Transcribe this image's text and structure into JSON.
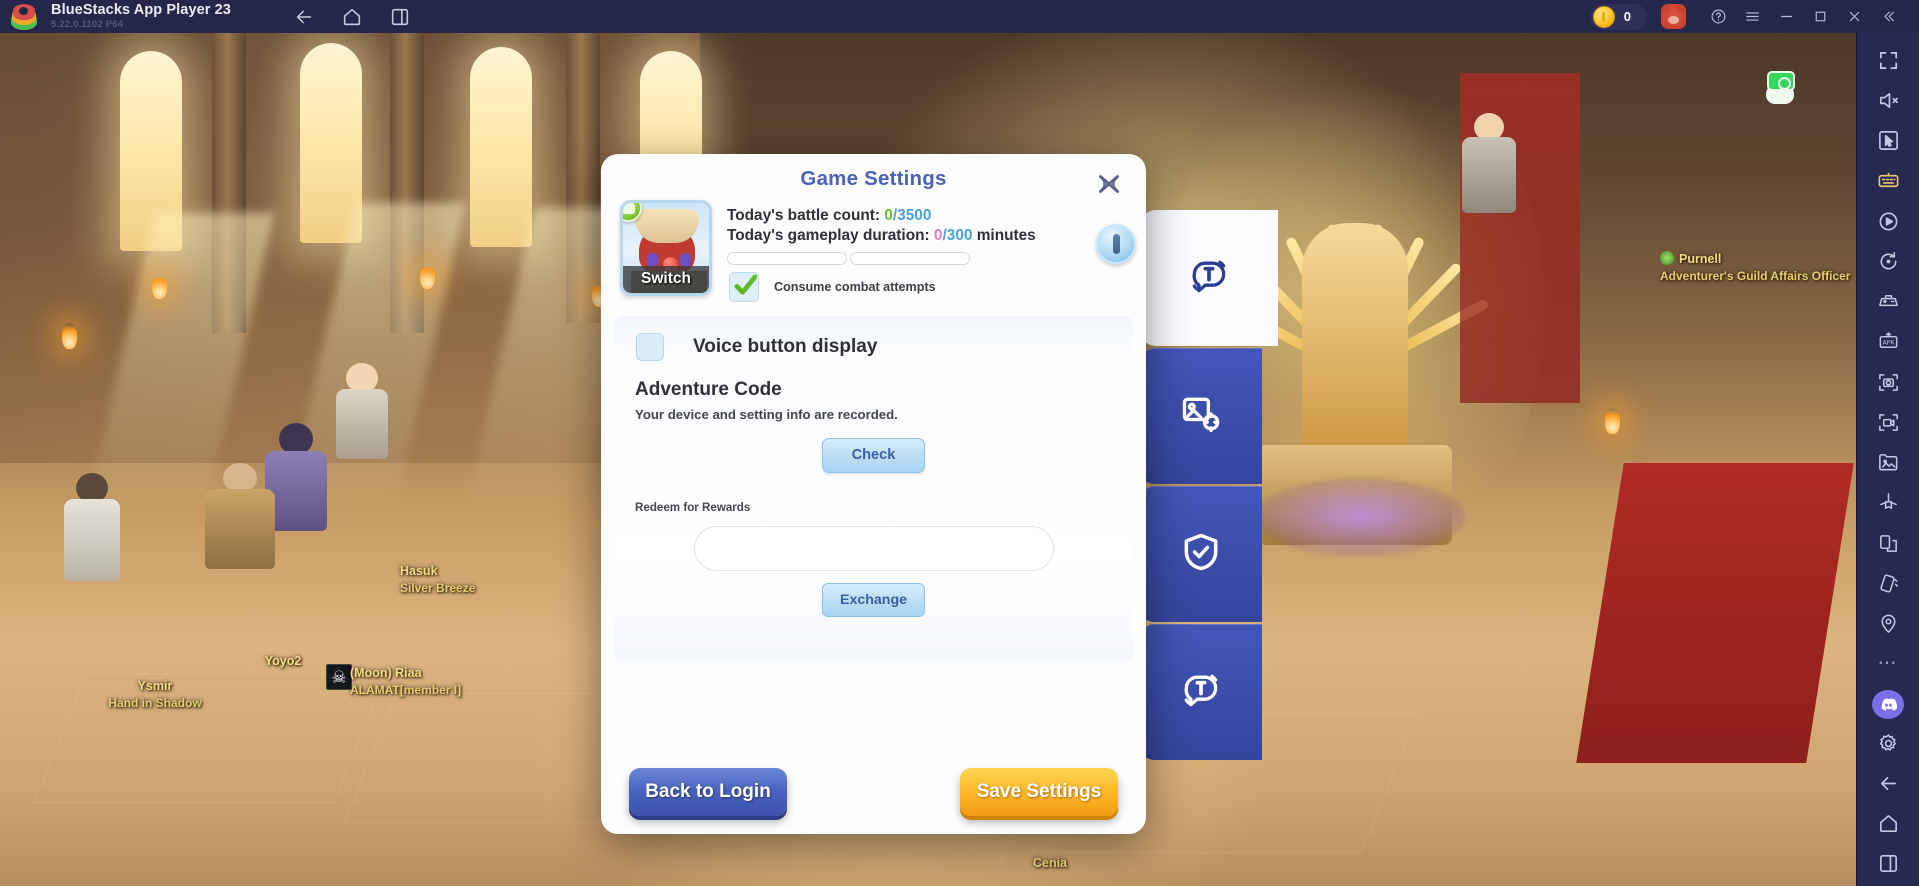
{
  "titlebar": {
    "app_name": "BlueStacks App Player 23",
    "version": "5.22.0.1102  P64",
    "nav": [
      {
        "name": "back-icon",
        "label": "Back"
      },
      {
        "name": "home-icon",
        "label": "Home"
      },
      {
        "name": "recents-icon",
        "label": "Recent apps"
      }
    ],
    "coin_value": "0",
    "controls": [
      {
        "name": "help-icon",
        "label": "Help"
      },
      {
        "name": "menu-icon",
        "label": "Menu"
      },
      {
        "name": "minimize-icon",
        "label": "Minimize"
      },
      {
        "name": "maximize-icon",
        "label": "Maximize"
      },
      {
        "name": "close-icon",
        "label": "Close"
      },
      {
        "name": "collapse-icon",
        "label": "Collapse"
      }
    ]
  },
  "dialog": {
    "title": "Game Settings",
    "close_label": "Close",
    "portrait": {
      "switch_label": "Switch"
    },
    "stats": {
      "battle_label": "Today's battle count: ",
      "battle_current": "0",
      "battle_max": "/3500",
      "duration_label": "Today's gameplay duration: ",
      "duration_current": "0",
      "duration_max": "/300",
      "duration_unit": "minutes",
      "info_label": "Info"
    },
    "consume_checkbox": {
      "label": "Consume combat attempts",
      "checked": "true"
    },
    "voice_checkbox": {
      "label": "Voice button display",
      "checked": "false"
    },
    "adventure": {
      "heading": "Adventure Code",
      "description": "Your device and setting info are recorded.",
      "check_button": "Check"
    },
    "redeem": {
      "label": "Redeem for Rewards",
      "input_value": "",
      "input_placeholder": "",
      "exchange_button": "Exchange"
    },
    "footer": {
      "back_button": "Back to Login",
      "save_button": "Save Settings"
    }
  },
  "game_tabs": [
    {
      "name": "tab-translate-chat-top",
      "icon": "translate-chat-icon",
      "active": "true"
    },
    {
      "name": "tab-graphics-settings",
      "icon": "image-gear-icon",
      "active": "false"
    },
    {
      "name": "tab-security",
      "icon": "shield-check-icon",
      "active": "false"
    },
    {
      "name": "tab-translate-chat-bottom",
      "icon": "translate-chat-icon",
      "active": "false"
    }
  ],
  "sidebar": [
    {
      "name": "fullscreen-icon",
      "label": "Full screen"
    },
    {
      "name": "mute-icon",
      "label": "Mute"
    },
    {
      "name": "cursor-icon",
      "label": "Pointer"
    },
    {
      "name": "keyboard-controls-icon",
      "label": "Game controls"
    },
    {
      "name": "macro-icon",
      "label": "Macros"
    },
    {
      "name": "rotate-icon",
      "label": "Rotate"
    },
    {
      "name": "gamepad-icon",
      "label": "Gamepad"
    },
    {
      "name": "apk-install-icon",
      "label": "Install APK"
    },
    {
      "name": "screenshot-icon",
      "label": "Screenshot"
    },
    {
      "name": "record-video-icon",
      "label": "Record screen"
    },
    {
      "name": "media-manager-icon",
      "label": "Media manager"
    },
    {
      "name": "eco-mode-icon",
      "label": "Eco mode"
    },
    {
      "name": "multi-instance-icon",
      "label": "Multi-instance"
    },
    {
      "name": "shake-icon",
      "label": "Shake"
    },
    {
      "name": "location-icon",
      "label": "Location"
    },
    {
      "name": "more-icon",
      "label": "More"
    },
    {
      "name": "discord-icon",
      "label": "Discord"
    },
    {
      "name": "settings-gear-icon",
      "label": "Settings"
    },
    {
      "name": "back-icon",
      "label": "Back"
    },
    {
      "name": "home-icon",
      "label": "Home"
    },
    {
      "name": "recents-icon",
      "label": "Recent apps"
    }
  ],
  "game_world": {
    "npc": {
      "name": "Purnell",
      "title": "Adventurer's Guild Affairs Officer"
    },
    "players": [
      {
        "name": "Ysmir",
        "title": "Hand in Shadow"
      },
      {
        "name": "Yoyo2",
        "title": ""
      },
      {
        "name": "(Moon) Riaa",
        "title": "ALAMAT[member I]"
      },
      {
        "name": "Hasuk",
        "title": "Silver Breeze"
      },
      {
        "name": "Cenia",
        "title": ""
      }
    ]
  }
}
